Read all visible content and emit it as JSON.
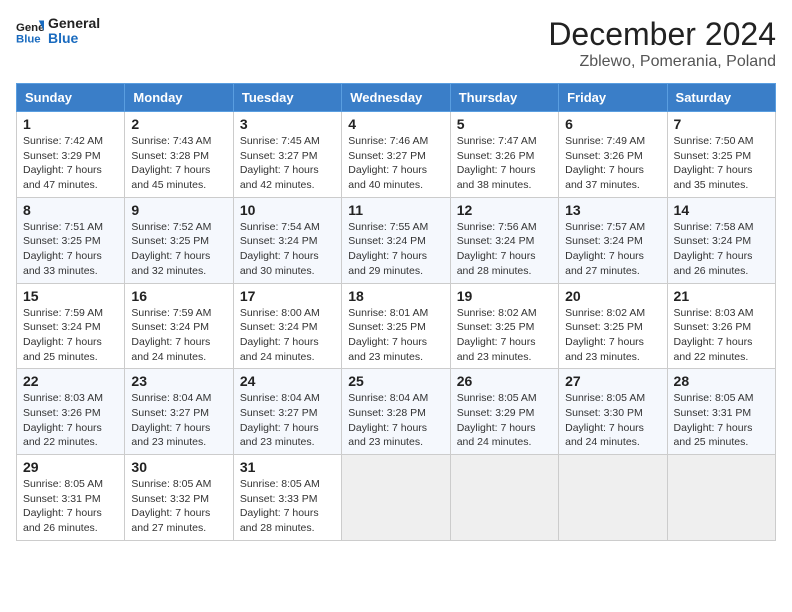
{
  "header": {
    "logo_line1": "General",
    "logo_line2": "Blue",
    "month": "December 2024",
    "location": "Zblewo, Pomerania, Poland"
  },
  "weekdays": [
    "Sunday",
    "Monday",
    "Tuesday",
    "Wednesday",
    "Thursday",
    "Friday",
    "Saturday"
  ],
  "weeks": [
    [
      {
        "day": 1,
        "sunrise": "7:42 AM",
        "sunset": "3:29 PM",
        "daylight": "7 hours and 47 minutes."
      },
      {
        "day": 2,
        "sunrise": "7:43 AM",
        "sunset": "3:28 PM",
        "daylight": "7 hours and 45 minutes."
      },
      {
        "day": 3,
        "sunrise": "7:45 AM",
        "sunset": "3:27 PM",
        "daylight": "7 hours and 42 minutes."
      },
      {
        "day": 4,
        "sunrise": "7:46 AM",
        "sunset": "3:27 PM",
        "daylight": "7 hours and 40 minutes."
      },
      {
        "day": 5,
        "sunrise": "7:47 AM",
        "sunset": "3:26 PM",
        "daylight": "7 hours and 38 minutes."
      },
      {
        "day": 6,
        "sunrise": "7:49 AM",
        "sunset": "3:26 PM",
        "daylight": "7 hours and 37 minutes."
      },
      {
        "day": 7,
        "sunrise": "7:50 AM",
        "sunset": "3:25 PM",
        "daylight": "7 hours and 35 minutes."
      }
    ],
    [
      {
        "day": 8,
        "sunrise": "7:51 AM",
        "sunset": "3:25 PM",
        "daylight": "7 hours and 33 minutes."
      },
      {
        "day": 9,
        "sunrise": "7:52 AM",
        "sunset": "3:25 PM",
        "daylight": "7 hours and 32 minutes."
      },
      {
        "day": 10,
        "sunrise": "7:54 AM",
        "sunset": "3:24 PM",
        "daylight": "7 hours and 30 minutes."
      },
      {
        "day": 11,
        "sunrise": "7:55 AM",
        "sunset": "3:24 PM",
        "daylight": "7 hours and 29 minutes."
      },
      {
        "day": 12,
        "sunrise": "7:56 AM",
        "sunset": "3:24 PM",
        "daylight": "7 hours and 28 minutes."
      },
      {
        "day": 13,
        "sunrise": "7:57 AM",
        "sunset": "3:24 PM",
        "daylight": "7 hours and 27 minutes."
      },
      {
        "day": 14,
        "sunrise": "7:58 AM",
        "sunset": "3:24 PM",
        "daylight": "7 hours and 26 minutes."
      }
    ],
    [
      {
        "day": 15,
        "sunrise": "7:59 AM",
        "sunset": "3:24 PM",
        "daylight": "7 hours and 25 minutes."
      },
      {
        "day": 16,
        "sunrise": "7:59 AM",
        "sunset": "3:24 PM",
        "daylight": "7 hours and 24 minutes."
      },
      {
        "day": 17,
        "sunrise": "8:00 AM",
        "sunset": "3:24 PM",
        "daylight": "7 hours and 24 minutes."
      },
      {
        "day": 18,
        "sunrise": "8:01 AM",
        "sunset": "3:25 PM",
        "daylight": "7 hours and 23 minutes."
      },
      {
        "day": 19,
        "sunrise": "8:02 AM",
        "sunset": "3:25 PM",
        "daylight": "7 hours and 23 minutes."
      },
      {
        "day": 20,
        "sunrise": "8:02 AM",
        "sunset": "3:25 PM",
        "daylight": "7 hours and 23 minutes."
      },
      {
        "day": 21,
        "sunrise": "8:03 AM",
        "sunset": "3:26 PM",
        "daylight": "7 hours and 22 minutes."
      }
    ],
    [
      {
        "day": 22,
        "sunrise": "8:03 AM",
        "sunset": "3:26 PM",
        "daylight": "7 hours and 22 minutes."
      },
      {
        "day": 23,
        "sunrise": "8:04 AM",
        "sunset": "3:27 PM",
        "daylight": "7 hours and 23 minutes."
      },
      {
        "day": 24,
        "sunrise": "8:04 AM",
        "sunset": "3:27 PM",
        "daylight": "7 hours and 23 minutes."
      },
      {
        "day": 25,
        "sunrise": "8:04 AM",
        "sunset": "3:28 PM",
        "daylight": "7 hours and 23 minutes."
      },
      {
        "day": 26,
        "sunrise": "8:05 AM",
        "sunset": "3:29 PM",
        "daylight": "7 hours and 24 minutes."
      },
      {
        "day": 27,
        "sunrise": "8:05 AM",
        "sunset": "3:30 PM",
        "daylight": "7 hours and 24 minutes."
      },
      {
        "day": 28,
        "sunrise": "8:05 AM",
        "sunset": "3:31 PM",
        "daylight": "7 hours and 25 minutes."
      }
    ],
    [
      {
        "day": 29,
        "sunrise": "8:05 AM",
        "sunset": "3:31 PM",
        "daylight": "7 hours and 26 minutes."
      },
      {
        "day": 30,
        "sunrise": "8:05 AM",
        "sunset": "3:32 PM",
        "daylight": "7 hours and 27 minutes."
      },
      {
        "day": 31,
        "sunrise": "8:05 AM",
        "sunset": "3:33 PM",
        "daylight": "7 hours and 28 minutes."
      },
      null,
      null,
      null,
      null
    ]
  ]
}
